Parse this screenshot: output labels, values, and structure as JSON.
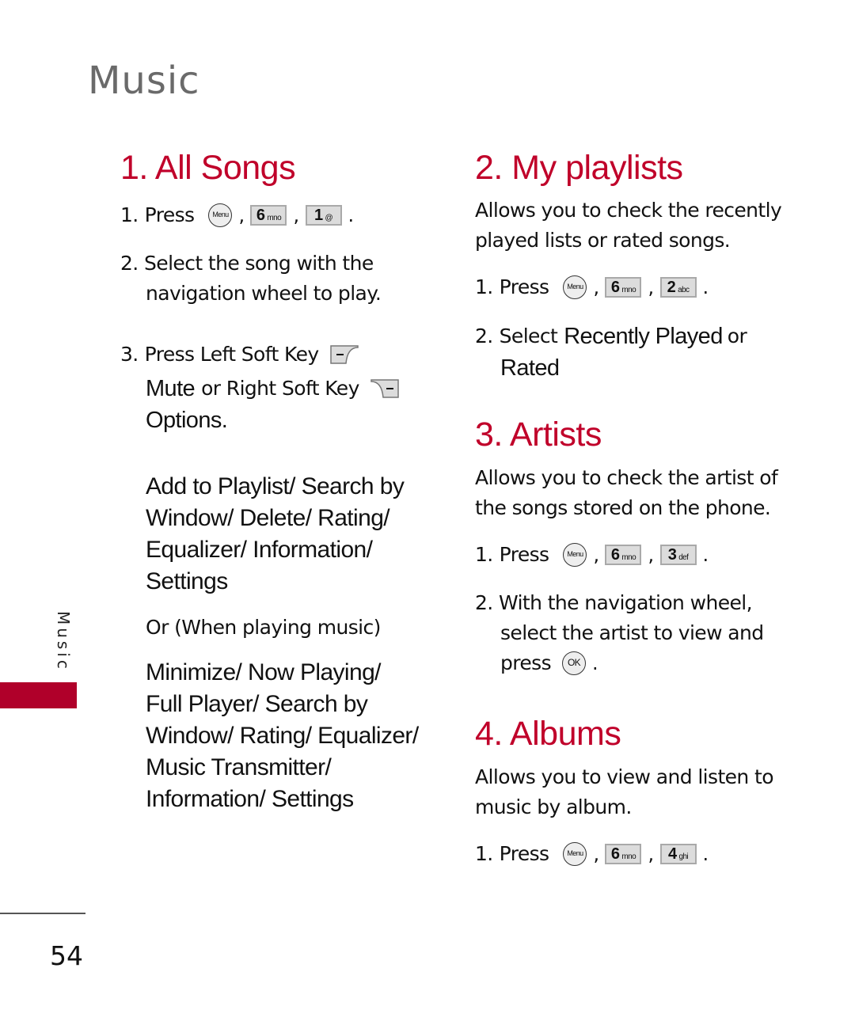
{
  "page": {
    "chapter_title": "Music",
    "side_tab_label": "Music",
    "page_number": "54",
    "accent_color": "#c0002a"
  },
  "keys": {
    "menu": "Menu",
    "ok": "OK",
    "six": {
      "digit": "6",
      "letters": "mno"
    },
    "one": {
      "digit": "1",
      "letters": "@"
    },
    "two": {
      "digit": "2",
      "letters": "abc"
    },
    "three": {
      "digit": "3",
      "letters": "def"
    },
    "four": {
      "digit": "4",
      "letters": "ghi"
    }
  },
  "sections": {
    "all_songs": {
      "heading": "1. All Songs",
      "step1": {
        "num": "1.",
        "text": "Press"
      },
      "step2": {
        "num": "2.",
        "line1": "Select the song with the",
        "line2": "navigation wheel to play."
      },
      "step3": {
        "num": "3.",
        "line1": "Press Left Soft Key",
        "mute": "Mute",
        "line2_mid": "or Right Soft Key",
        "options": "Options."
      },
      "options_list": [
        "Add to Playlist/ Search by",
        "Window/ Delete/ Rating/",
        "Equalizer/ Information/",
        "Settings"
      ],
      "or_playing": "Or (When playing music)",
      "playing_list": [
        "Minimize/ Now Playing/",
        "Full Player/ Search by",
        "Window/ Rating/ Equalizer/",
        "Music Transmitter/",
        "Information/ Settings"
      ]
    },
    "my_playlists": {
      "heading": "2. My playlists",
      "desc": [
        "Allows you to check the recently",
        "played lists or rated songs."
      ],
      "step1": {
        "num": "1.",
        "text": "Press"
      },
      "step2": {
        "num": "2.",
        "select": "Select",
        "recently": "Recently Played",
        "or": "or",
        "rated": "Rated"
      }
    },
    "artists": {
      "heading": "3. Artists",
      "desc": [
        "Allows you to check the artist of",
        "the songs stored on the phone."
      ],
      "step1": {
        "num": "1.",
        "text": "Press"
      },
      "step2": {
        "num": "2.",
        "line1": "With the navigation wheel,",
        "line2": "select the artist to view and",
        "line3": "press"
      }
    },
    "albums": {
      "heading": "4. Albums",
      "desc": [
        "Allows you to view and listen to",
        "music by album."
      ],
      "step1": {
        "num": "1.",
        "text": "Press"
      }
    }
  }
}
